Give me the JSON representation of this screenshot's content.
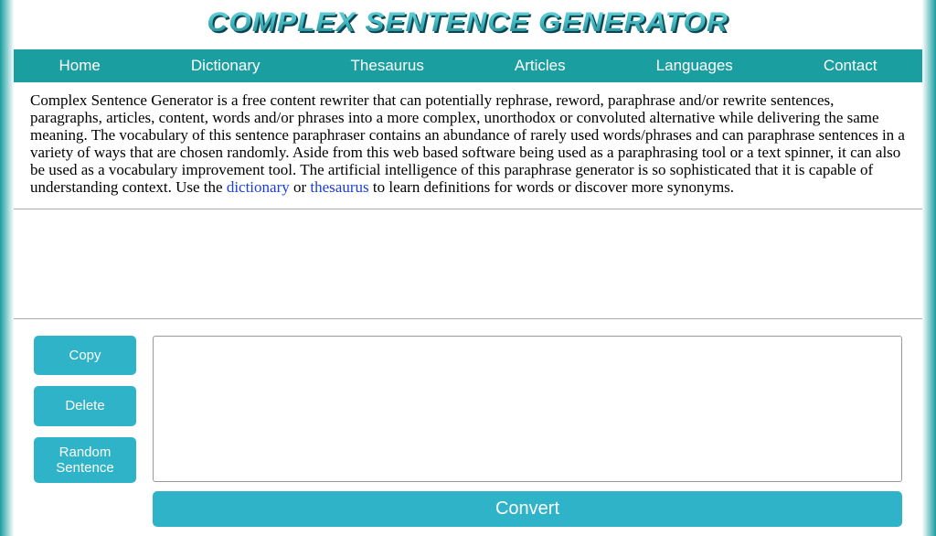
{
  "header": {
    "logo": "Complex Sentence Generator"
  },
  "nav": {
    "items": [
      {
        "label": "Home"
      },
      {
        "label": "Dictionary"
      },
      {
        "label": "Thesaurus"
      },
      {
        "label": "Articles"
      },
      {
        "label": "Languages"
      },
      {
        "label": "Contact"
      }
    ]
  },
  "description": {
    "text_before": "Complex Sentence Generator is a free content rewriter that can potentially rephrase, reword, paraphrase and/or rewrite sentences, paragraphs, articles, content, words and/or phrases into a more complex, unorthodox or convoluted alternative while delivering the same meaning. The vocabulary of this sentence paraphraser contains an abundance of rarely used words/phrases and can paraphrase sentences in a variety of ways that are chosen randomly. Aside from this web based software being used as a paraphrasing tool or a text spinner, it can also be used as a vocabulary improvement tool. The artificial intelligence of this paraphrase generator is so sophisticated that it is capable of understanding context. Use the ",
    "link1": "dictionary",
    "text_mid": " or ",
    "link2": "thesaurus",
    "text_after": " to learn definitions for words or discover more synonyms."
  },
  "buttons": {
    "copy": "Copy",
    "delete": "Delete",
    "random": "Random Sentence",
    "convert": "Convert"
  },
  "input": {
    "value": "",
    "placeholder": ""
  }
}
